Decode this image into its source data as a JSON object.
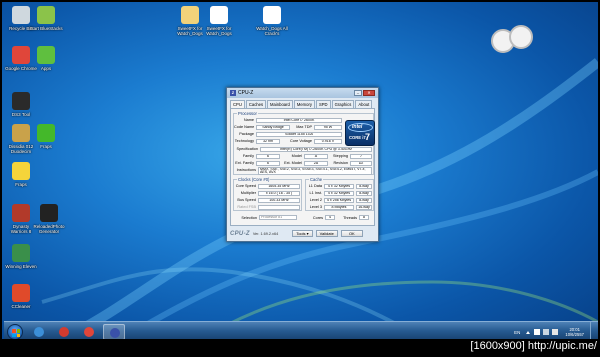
{
  "desktop": {
    "icons": [
      {
        "label": "Recycle Bin",
        "icon": "recycle-bin-icon",
        "color": "#cfd8de"
      },
      {
        "label": "Start BlueStacks",
        "icon": "bluestacks-icon",
        "color": "#8bc34a"
      },
      {
        "label": "SweetFX for Watch_Dogs",
        "icon": "folder-icon",
        "color": "#f2d27a"
      },
      {
        "label": "SweetFX for Watch_Dogs",
        "icon": "document-icon",
        "color": "#ffffff"
      },
      {
        "label": "Watch_Dogs All Crack's",
        "icon": "document-icon",
        "color": "#ffffff"
      },
      {
        "label": "Google Chrome",
        "icon": "chrome-icon",
        "color": "#e0463a"
      },
      {
        "label": "Apps",
        "icon": "apps-icon",
        "color": "#5fbf3f"
      },
      {
        "label": "DS3 Tool",
        "icon": "gamepad-icon",
        "color": "#2a2a2a"
      },
      {
        "label": "Dissidia 012 Duodecim",
        "icon": "game-icon",
        "color": "#c9a24a"
      },
      {
        "label": "Fraps",
        "icon": "fraps-icon",
        "color": "#44b82a"
      },
      {
        "label": "Fraps",
        "icon": "fraps-99-icon",
        "color": "#f5d43a"
      },
      {
        "label": "Dynasty Warriors 8",
        "icon": "game-icon",
        "color": "#b23a2a"
      },
      {
        "label": "ReloadedPhoto Generator",
        "icon": "rp-icon",
        "color": "#222222"
      },
      {
        "label": "Winning Eleven",
        "icon": "game-icon",
        "color": "#3a8f4a"
      },
      {
        "label": "CCleaner",
        "icon": "ccleaner-icon",
        "color": "#e04a2a"
      }
    ]
  },
  "cpuz": {
    "title": "CPU-Z",
    "app_icon": "Z",
    "tabs": [
      "CPU",
      "Caches",
      "Mainboard",
      "Memory",
      "SPD",
      "Graphics",
      "About"
    ],
    "processor": {
      "group": "Processor",
      "name_label": "Name",
      "name": "Intel Core i7 2600K",
      "codename_label": "Code Name",
      "codename": "Sandy Bridge",
      "maxtdp_label": "Max TDP",
      "maxtdp": "95 W",
      "package_label": "Package",
      "package": "Socket 1155 LGA",
      "technology_label": "Technology",
      "technology": "32 nm",
      "corevoltage_label": "Core Voltage",
      "corevoltage": "0.916 V",
      "spec_label": "Specification",
      "spec": "Intel(R) Core(TM) i7-2600K CPU @ 3.40GHz",
      "family_label": "Family",
      "family": "6",
      "model_label": "Model",
      "model": "A",
      "stepping_label": "Stepping",
      "stepping": "7",
      "extfamily_label": "Ext. Family",
      "extfamily": "6",
      "extmodel_label": "Ext. Model",
      "extmodel": "2A",
      "revision_label": "Revision",
      "revision": "D2",
      "instructions_label": "Instructions",
      "instructions": "MMX, SSE, SSE2, SSE3, SSSE3, SSE4.1, SSE4.2, EM64T, VT-x, AES, AVX",
      "logo_brand": "intel",
      "logo_line": "CORE i7",
      "logo_number": "7"
    },
    "clocks": {
      "group": "Clocks (Core #0)",
      "corespeed_label": "Core Speed",
      "corespeed": "1605.35 MHz",
      "multiplier_label": "Multiplier",
      "multiplier": "x 16.0 ( 16 - 35 )",
      "busspeed_label": "Bus Speed",
      "busspeed": "100.33 MHz",
      "ratedfsb_label": "Rated FSB",
      "ratedfsb": ""
    },
    "cache": {
      "group": "Cache",
      "l1d_label": "L1 Data",
      "l1d": "4 x 32 KBytes",
      "l1d_way": "8-way",
      "l1i_label": "L1 Inst.",
      "l1i": "4 x 32 KBytes",
      "l1i_way": "8-way",
      "l2_label": "Level 2",
      "l2": "4 x 256 KBytes",
      "l2_way": "8-way",
      "l3_label": "Level 3",
      "l3": "8 MBytes",
      "l3_way": "16-way"
    },
    "selection_label": "Selection",
    "selection": "Processor #1",
    "cores_label": "Cores",
    "cores": "4",
    "threads_label": "Threads",
    "threads": "8",
    "brand": "CPU-Z",
    "version": "Ver. 1.69.2.x64",
    "tools_label": "Tools",
    "validate_label": "Validate",
    "ok_label": "OK"
  },
  "taskbar": {
    "pinned": [
      {
        "icon": "ie-icon",
        "color": "#3c8fd8"
      },
      {
        "icon": "user-icon",
        "color": "#d23b2f"
      },
      {
        "icon": "chrome-icon",
        "color": "#e0463a"
      },
      {
        "icon": "cpuz-icon",
        "color": "#3a51a8"
      }
    ],
    "lang": "EN",
    "time": "20:01",
    "date": "10/6/2557"
  },
  "watermark": "[1600x900] http://upic.me/"
}
